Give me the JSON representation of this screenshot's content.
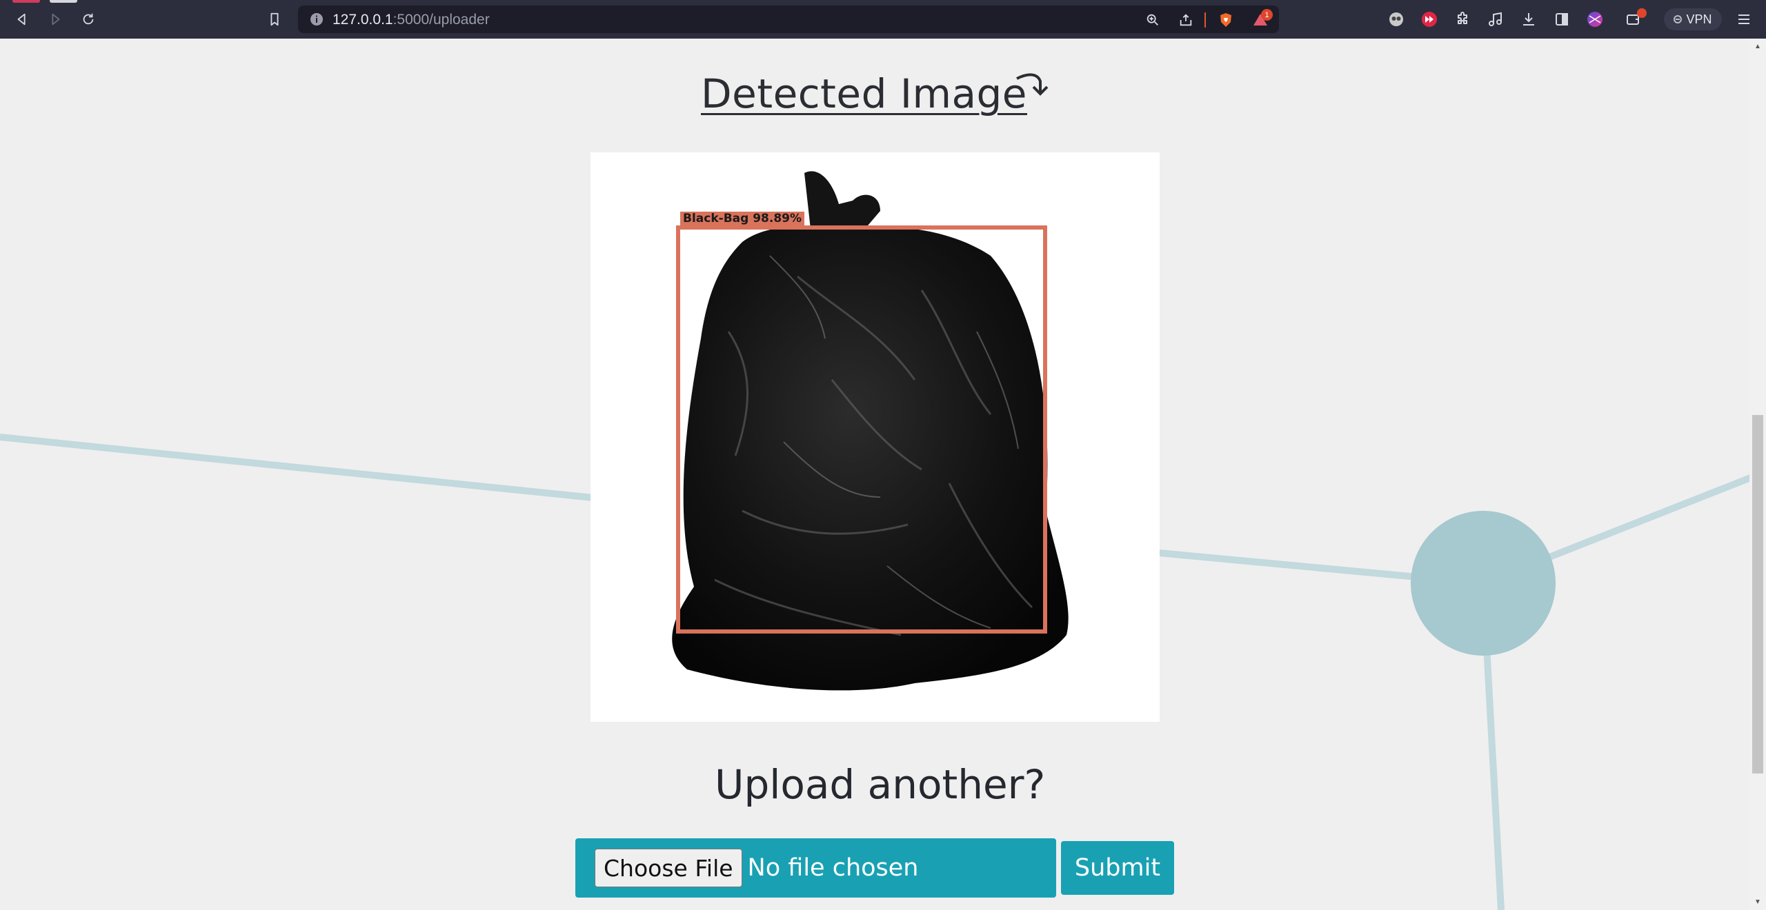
{
  "browser": {
    "url_host": "127.0.0.1",
    "url_path": ":5000/uploader",
    "notification_count": "1",
    "vpn_label": "VPN",
    "icons": [
      "back-icon",
      "forward-icon",
      "reload-icon",
      "bookmark-icon",
      "site-info-icon",
      "zoom-icon",
      "share-icon",
      "brave-shield-icon",
      "brave-rewards-icon",
      "extension-icon",
      "puzzle-icon",
      "music-icon",
      "download-icon",
      "sidebar-icon",
      "profile-icon",
      "wallet-icon",
      "vpn-icon",
      "menu-icon"
    ]
  },
  "page": {
    "title": "Detected Image",
    "detection_label": "Black-Bag 98.89%",
    "subtitle": "Upload another?",
    "choose_file_label": "Choose File",
    "no_file_text": "No file chosen",
    "submit_label": "Submit"
  },
  "colors": {
    "teal": "#19a1b3",
    "detection_box": "#d9735b",
    "background": "#efefef",
    "network_line": "#a9cbd2"
  }
}
